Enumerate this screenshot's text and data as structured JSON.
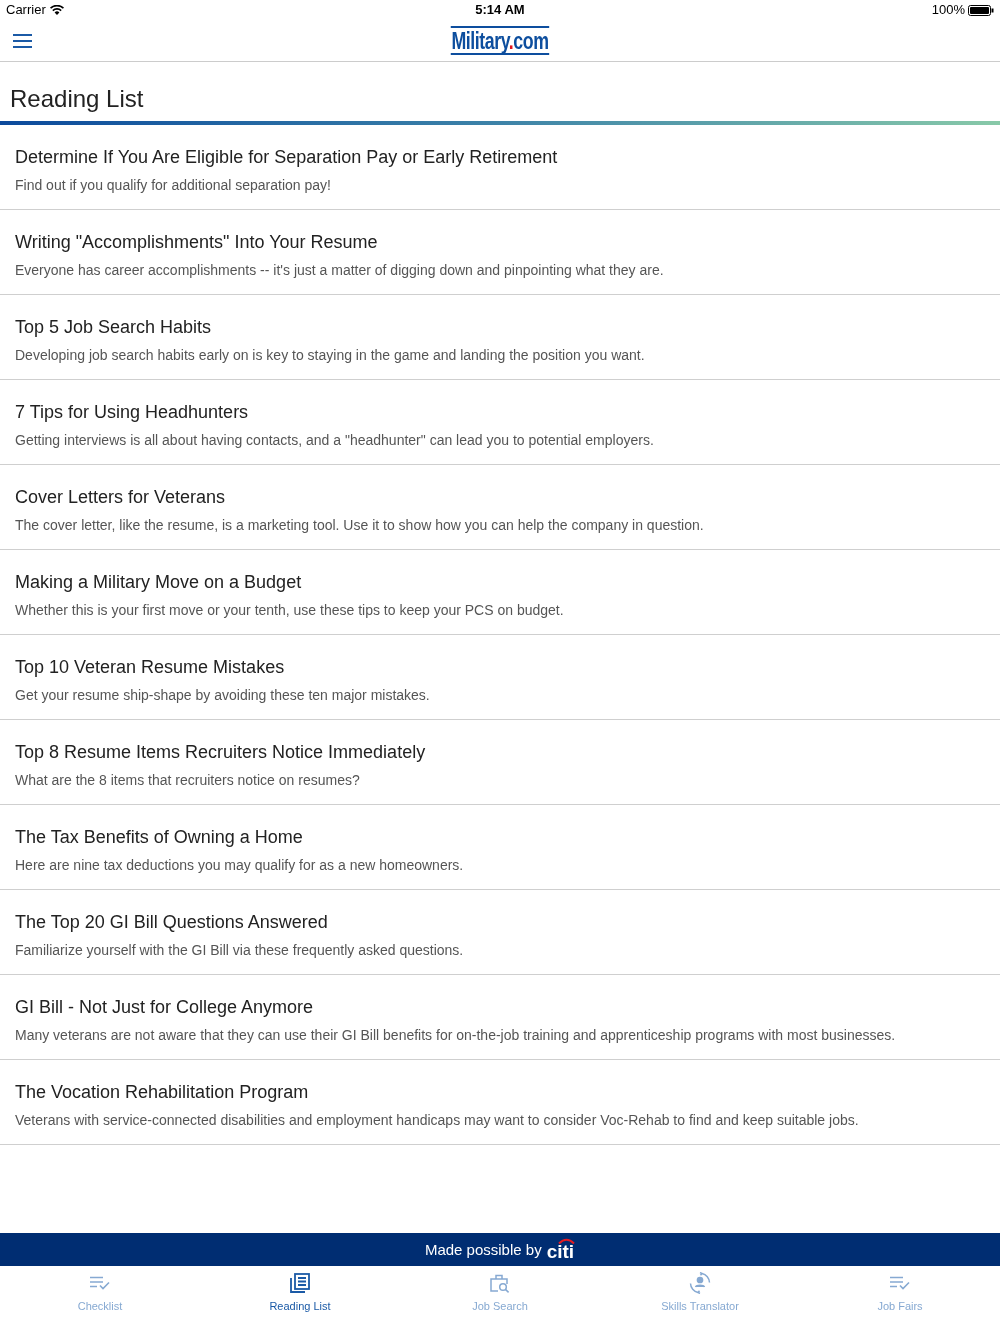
{
  "status_bar": {
    "carrier": "Carrier",
    "time": "5:14 AM",
    "battery": "100%"
  },
  "header": {
    "logo": [
      {
        "text": "Military",
        "color": "#0d4e9e"
      },
      {
        "text": ".",
        "color": "#e0141e"
      },
      {
        "text": "com",
        "color": "#0d4e9e"
      }
    ]
  },
  "page_title": "Reading List",
  "articles": [
    {
      "title": "Determine If You Are Eligible for Separation Pay or Early Retirement",
      "summary": "Find out if you qualify for additional separation pay!"
    },
    {
      "title": "Writing \"Accomplishments\" Into Your Resume",
      "summary": "Everyone has career accomplishments -- it's just a matter of digging down and pinpointing what they are."
    },
    {
      "title": "Top 5 Job Search Habits",
      "summary": "Developing job search habits early on is key to staying in the game and landing the position you want."
    },
    {
      "title": "7 Tips for Using Headhunters",
      "summary": "Getting interviews is all about having contacts, and a \"headhunter\" can lead you to potential employers."
    },
    {
      "title": "Cover Letters for Veterans",
      "summary": "The cover letter, like the resume, is a marketing tool. Use it to show how you can help the company in question."
    },
    {
      "title": "Making a Military Move on a Budget",
      "summary": "Whether this is your first move or your tenth, use these tips to keep your PCS on budget."
    },
    {
      "title": "Top 10 Veteran Resume Mistakes",
      "summary": "Get your resume ship-shape by avoiding these ten major mistakes."
    },
    {
      "title": "Top 8 Resume Items Recruiters Notice Immediately",
      "summary": "What are the 8 items that recruiters notice on resumes?"
    },
    {
      "title": "The Tax Benefits of Owning a Home",
      "summary": "Here are nine tax deductions you may qualify for as a new homeowners."
    },
    {
      "title": "The Top 20 GI Bill Questions Answered",
      "summary": "Familiarize yourself with the GI Bill via these frequently asked questions."
    },
    {
      "title": "GI Bill - Not Just for College Anymore",
      "summary": "Many veterans are not aware that they can use their GI Bill benefits for on-the-job training and apprenticeship programs with most businesses."
    },
    {
      "title": "The Vocation Rehabilitation Program",
      "summary": "Veterans with service-connected disabilities and employment handicaps may want to consider Voc-Rehab to find and keep suitable jobs."
    }
  ],
  "sponsor_banner": {
    "text": "Made possible by",
    "sponsor": "citi"
  },
  "tab_bar": [
    {
      "label": "Checklist",
      "kind": "checklist",
      "selected": false
    },
    {
      "label": "Reading List",
      "kind": "reading",
      "selected": true
    },
    {
      "label": "Job Search",
      "kind": "jobsearch",
      "selected": false
    },
    {
      "label": "Skills Translator",
      "kind": "translator",
      "selected": false
    },
    {
      "label": "Job Fairs",
      "kind": "checklist",
      "selected": false
    }
  ]
}
